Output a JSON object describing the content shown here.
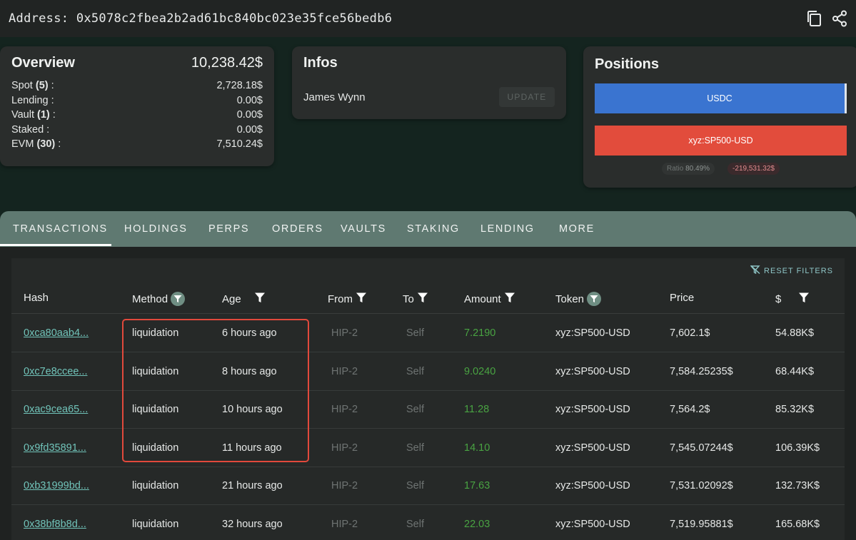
{
  "address": {
    "label": "Address: 0x5078c2fbea2b2ad61bc840bc023e35fce56bedb6",
    "icons": [
      "copy-icon",
      "share-icon"
    ]
  },
  "overview": {
    "title": "Overview",
    "total": "10,238.42$",
    "rows": [
      {
        "label": "Spot",
        "count": "(5)",
        "suffix": " :",
        "value": "2,728.18$"
      },
      {
        "label": "Lending :",
        "count": "",
        "suffix": "",
        "value": "0.00$"
      },
      {
        "label": "Vault",
        "count": "(1)",
        "suffix": " :",
        "value": "0.00$"
      },
      {
        "label": "Staked :",
        "count": "",
        "suffix": "",
        "value": "0.00$"
      },
      {
        "label": "EVM",
        "count": "(30)",
        "suffix": " :",
        "value": "7,510.24$"
      }
    ]
  },
  "infos": {
    "title": "Infos",
    "name": "James Wynn",
    "update_label": "UPDATE"
  },
  "positions": {
    "title": "Positions",
    "long_label": "USDC",
    "short_label": "xyz:SP500-USD",
    "ratio_label": "Ratio",
    "ratio_value": "80.49%",
    "pnl": "-219,531.32$",
    "colors": {
      "long": "#3a74d0",
      "short": "#e24c3c"
    }
  },
  "tabs": [
    "TRANSACTIONS",
    "HOLDINGS",
    "PERPS",
    "ORDERS",
    "VAULTS",
    "STAKING",
    "LENDING",
    "MORE"
  ],
  "table": {
    "reset_filters": "RESET FILTERS",
    "headers": {
      "hash": "Hash",
      "method": "Method",
      "age": "Age",
      "from": "From",
      "to": "To",
      "amount": "Amount",
      "token": "Token",
      "price": "Price",
      "usd": "$"
    },
    "rows": [
      {
        "hash": "0xca80aab4...",
        "method": "liquidation",
        "age": "6 hours ago",
        "from": "HIP-2",
        "to": "Self",
        "amount": "7.2190",
        "token": "xyz:SP500-USD",
        "price": "7,602.1$",
        "usd": "54.88K$"
      },
      {
        "hash": "0xc7e8ccee...",
        "method": "liquidation",
        "age": "8 hours ago",
        "from": "HIP-2",
        "to": "Self",
        "amount": "9.0240",
        "token": "xyz:SP500-USD",
        "price": "7,584.25235$",
        "usd": "68.44K$"
      },
      {
        "hash": "0xac9cea65...",
        "method": "liquidation",
        "age": "10 hours ago",
        "from": "HIP-2",
        "to": "Self",
        "amount": "11.28",
        "token": "xyz:SP500-USD",
        "price": "7,564.2$",
        "usd": "85.32K$"
      },
      {
        "hash": "0x9fd35891...",
        "method": "liquidation",
        "age": "11 hours ago",
        "from": "HIP-2",
        "to": "Self",
        "amount": "14.10",
        "token": "xyz:SP500-USD",
        "price": "7,545.07244$",
        "usd": "106.39K$"
      },
      {
        "hash": "0xb31999bd...",
        "method": "liquidation",
        "age": "21 hours ago",
        "from": "HIP-2",
        "to": "Self",
        "amount": "17.63",
        "token": "xyz:SP500-USD",
        "price": "7,531.02092$",
        "usd": "132.73K$"
      },
      {
        "hash": "0x38bf8b8d...",
        "method": "liquidation",
        "age": "32 hours ago",
        "from": "HIP-2",
        "to": "Self",
        "amount": "22.03",
        "token": "xyz:SP500-USD",
        "price": "7,519.95881$",
        "usd": "165.68K$"
      }
    ]
  }
}
